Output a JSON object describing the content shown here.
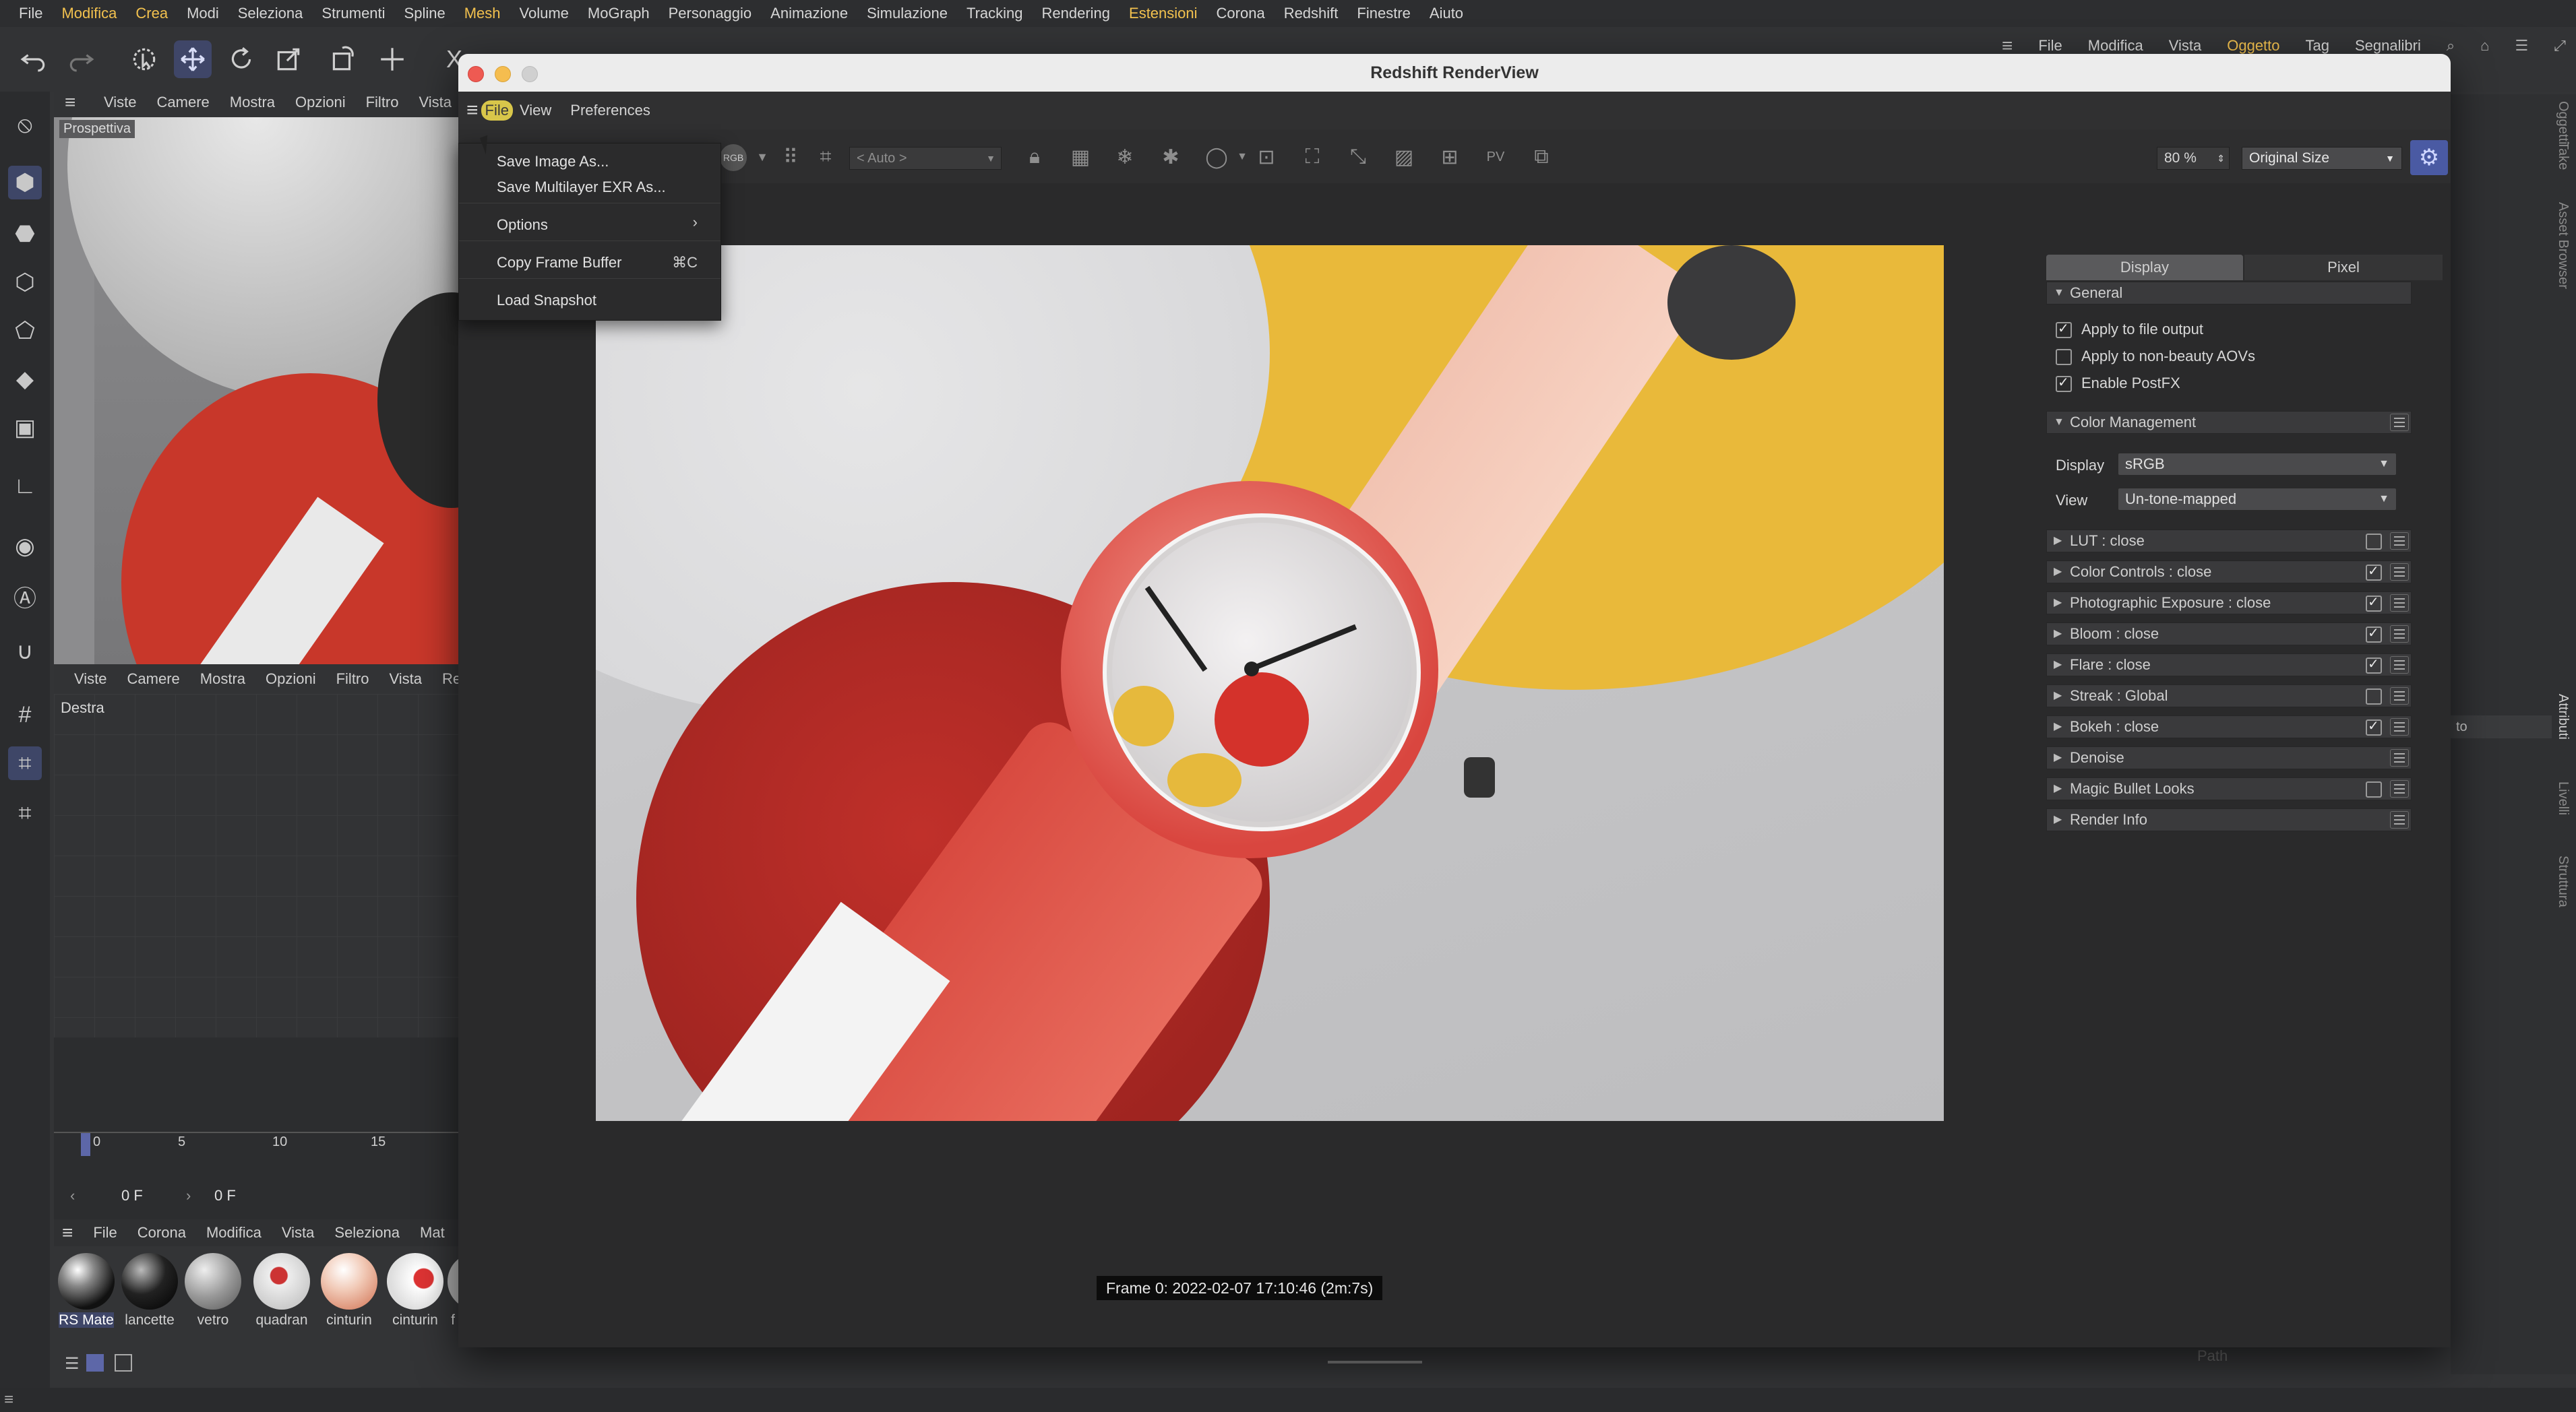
{
  "top_menu": {
    "items": [
      "File",
      "Modifica",
      "Crea",
      "Modi",
      "Seleziona",
      "Strumenti",
      "Spline",
      "Mesh",
      "Volume",
      "MoGraph",
      "Personaggio",
      "Animazione",
      "Simulazione",
      "Tracking",
      "Rendering",
      "Estensioni",
      "Corona",
      "Redshift",
      "Finestre",
      "Aiuto"
    ],
    "highlighted": [
      "Modifica",
      "Crea",
      "Mesh",
      "Estensioni"
    ]
  },
  "attr_menu": {
    "items": [
      "File",
      "Modifica",
      "Vista",
      "Oggetto",
      "Tag",
      "Segnalibri"
    ],
    "highlighted": "Oggetto"
  },
  "viewport_top": {
    "menu": [
      "Viste",
      "Camere",
      "Mostra",
      "Opzioni",
      "Filtro",
      "Vista"
    ],
    "label": "Prospettiva"
  },
  "viewport_bottom": {
    "menu": [
      "Viste",
      "Camere",
      "Mostra",
      "Opzioni",
      "Filtro",
      "Vista",
      "Re"
    ],
    "label": "Destra"
  },
  "render_window": {
    "title": "Redshift RenderView",
    "menu": [
      "File",
      "View",
      "Preferences"
    ],
    "toolbar": {
      "channel_chip": "RGB",
      "auto_select": "< Auto >",
      "zoom": "80 %",
      "size_select": "Original Size"
    },
    "frame_label": "Frame  0:  2022-02-07  17:10:46  (2m:7s)"
  },
  "file_menu": {
    "items": [
      {
        "label": "Save Image As...",
        "shortcut": ""
      },
      {
        "label": "Save Multilayer EXR As...",
        "shortcut": ""
      },
      {
        "label": "Options",
        "shortcut": "›"
      },
      {
        "label": "Copy Frame Buffer",
        "shortcut": "⌘C"
      },
      {
        "label": "Load Snapshot",
        "shortcut": ""
      }
    ]
  },
  "rs_panel": {
    "tabs": [
      "Display",
      "Pixel"
    ],
    "active_tab": "Display",
    "general": {
      "title": "General",
      "options": [
        {
          "label": "Apply to file output",
          "checked": true
        },
        {
          "label": "Apply to non-beauty AOVs",
          "checked": false
        },
        {
          "label": "Enable PostFX",
          "checked": true
        }
      ]
    },
    "color_management": {
      "title": "Color Management",
      "display_label": "Display",
      "display_value": "sRGB",
      "view_label": "View",
      "view_value": "Un-tone-mapped"
    },
    "sections": [
      {
        "label": "LUT  : close",
        "checkbox": true,
        "checked": false
      },
      {
        "label": "Color Controls  : close",
        "checkbox": true,
        "checked": true
      },
      {
        "label": "Photographic Exposure  : close",
        "checkbox": true,
        "checked": true
      },
      {
        "label": "Bloom  : close",
        "checkbox": true,
        "checked": true
      },
      {
        "label": "Flare  : close",
        "checkbox": true,
        "checked": true
      },
      {
        "label": "Streak  : Global",
        "checkbox": true,
        "checked": false
      },
      {
        "label": "Bokeh  : close",
        "checkbox": true,
        "checked": true
      },
      {
        "label": "Denoise",
        "checkbox": false,
        "checked": false
      },
      {
        "label": "Magic Bullet Looks",
        "checkbox": true,
        "checked": false
      },
      {
        "label": "Render Info",
        "checkbox": false,
        "checked": false
      }
    ]
  },
  "timeline": {
    "ticks": [
      "0",
      "5",
      "10",
      "15"
    ],
    "frame_start": "0 F",
    "frame_end": "0 F"
  },
  "material_manager": {
    "menu": [
      "File",
      "Corona",
      "Modifica",
      "Vista",
      "Seleziona",
      "Mat"
    ],
    "materials": [
      "RS Mate",
      "lancette",
      "vetro",
      "quadran",
      "cinturin",
      "cinturin",
      "f"
    ]
  },
  "side_labels": {
    "top": [
      "Oggetti",
      "Take",
      "Asset Browser"
    ],
    "bottom": [
      "Attributi",
      "Livelli",
      "Struttura"
    ],
    "path": "Path",
    "attr_field": "to"
  },
  "colors": {
    "accent_active": "#3f4668",
    "highlight_menu": "#f2c14e",
    "render_bg": "#c9c9cb"
  }
}
